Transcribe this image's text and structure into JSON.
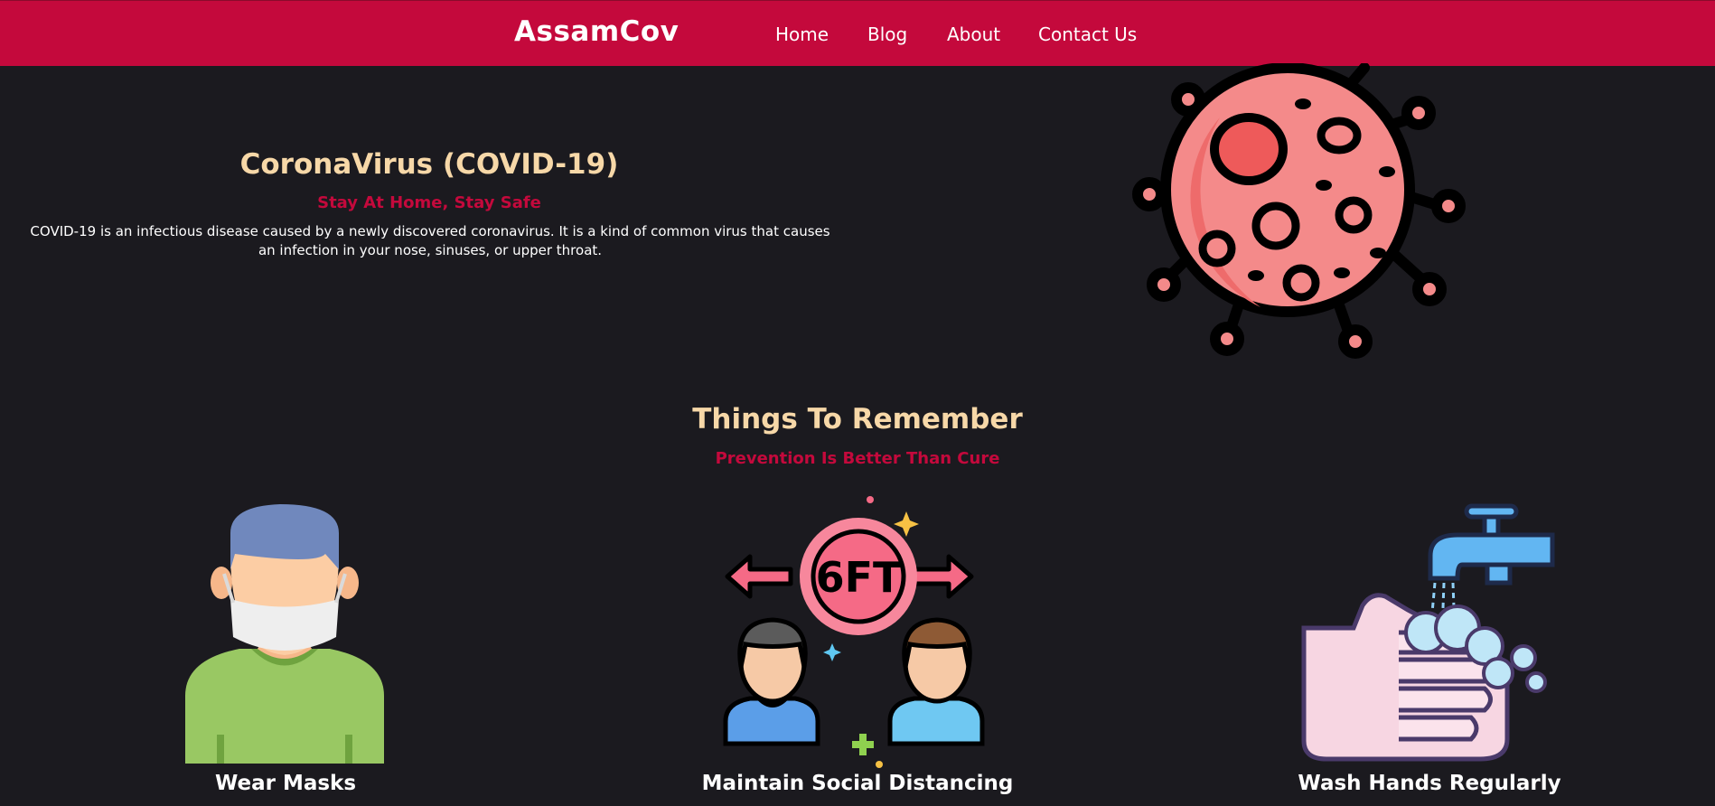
{
  "nav": {
    "brand": "AssamCov",
    "links": [
      "Home",
      "Blog",
      "About",
      "Contact Us"
    ]
  },
  "hero": {
    "title": "CoronaVirus (COVID-19)",
    "subtitle": "Stay At Home, Stay Safe",
    "description": "COVID-19 is an infectious disease caused by a newly discovered coronavirus. It is a kind of common virus that causes an infection in your nose, sinuses, or upper throat.",
    "image_icon": "virus-illustration"
  },
  "remember": {
    "title": "Things To Remember",
    "subtitle": "Prevention Is Better Than Cure",
    "cards": [
      {
        "label": "Wear Masks",
        "icon": "masked-person-icon"
      },
      {
        "label": "Maintain Social Distancing",
        "icon": "social-distancing-icon",
        "badge_text": "6FT"
      },
      {
        "label": "Wash Hands Regularly",
        "icon": "hand-washing-icon"
      }
    ]
  },
  "colors": {
    "navbar": "#c4093c",
    "background": "#1b1a1f",
    "heading": "#f7d8a8",
    "accent": "#c4093c"
  }
}
